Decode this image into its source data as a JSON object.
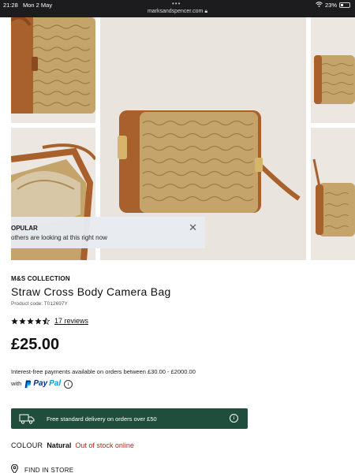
{
  "status_bar": {
    "time": "21:28",
    "date": "Mon 2 May",
    "url": "marksandspencer.com",
    "battery": "23%"
  },
  "toast": {
    "title": "OPULAR",
    "message": "others are looking at this right now"
  },
  "product": {
    "brand": "M&S COLLECTION",
    "title": "Straw Cross Body Camera Bag",
    "code": "Product code: T012697Y",
    "rating": 4.5,
    "reviews": "17 reviews",
    "price": "£25.00"
  },
  "payment": {
    "interest_text": "Interest-free payments available on orders between £30.00 - £2000.00",
    "with": "with",
    "paypal_a": "Pay",
    "paypal_b": "Pal"
  },
  "delivery": {
    "text": "Free standard delivery on orders over £50"
  },
  "colour": {
    "label": "COLOUR",
    "value": "Natural",
    "stock": "Out of stock online"
  },
  "store": {
    "label": "FIND IN STORE"
  },
  "colors": {
    "delivery_bg": "#1f4e3d",
    "out_of_stock": "#b3261e",
    "paypal_dark": "#003087",
    "paypal_light": "#009cde",
    "straw": "#c4a46a",
    "leather": "#a8602c"
  }
}
